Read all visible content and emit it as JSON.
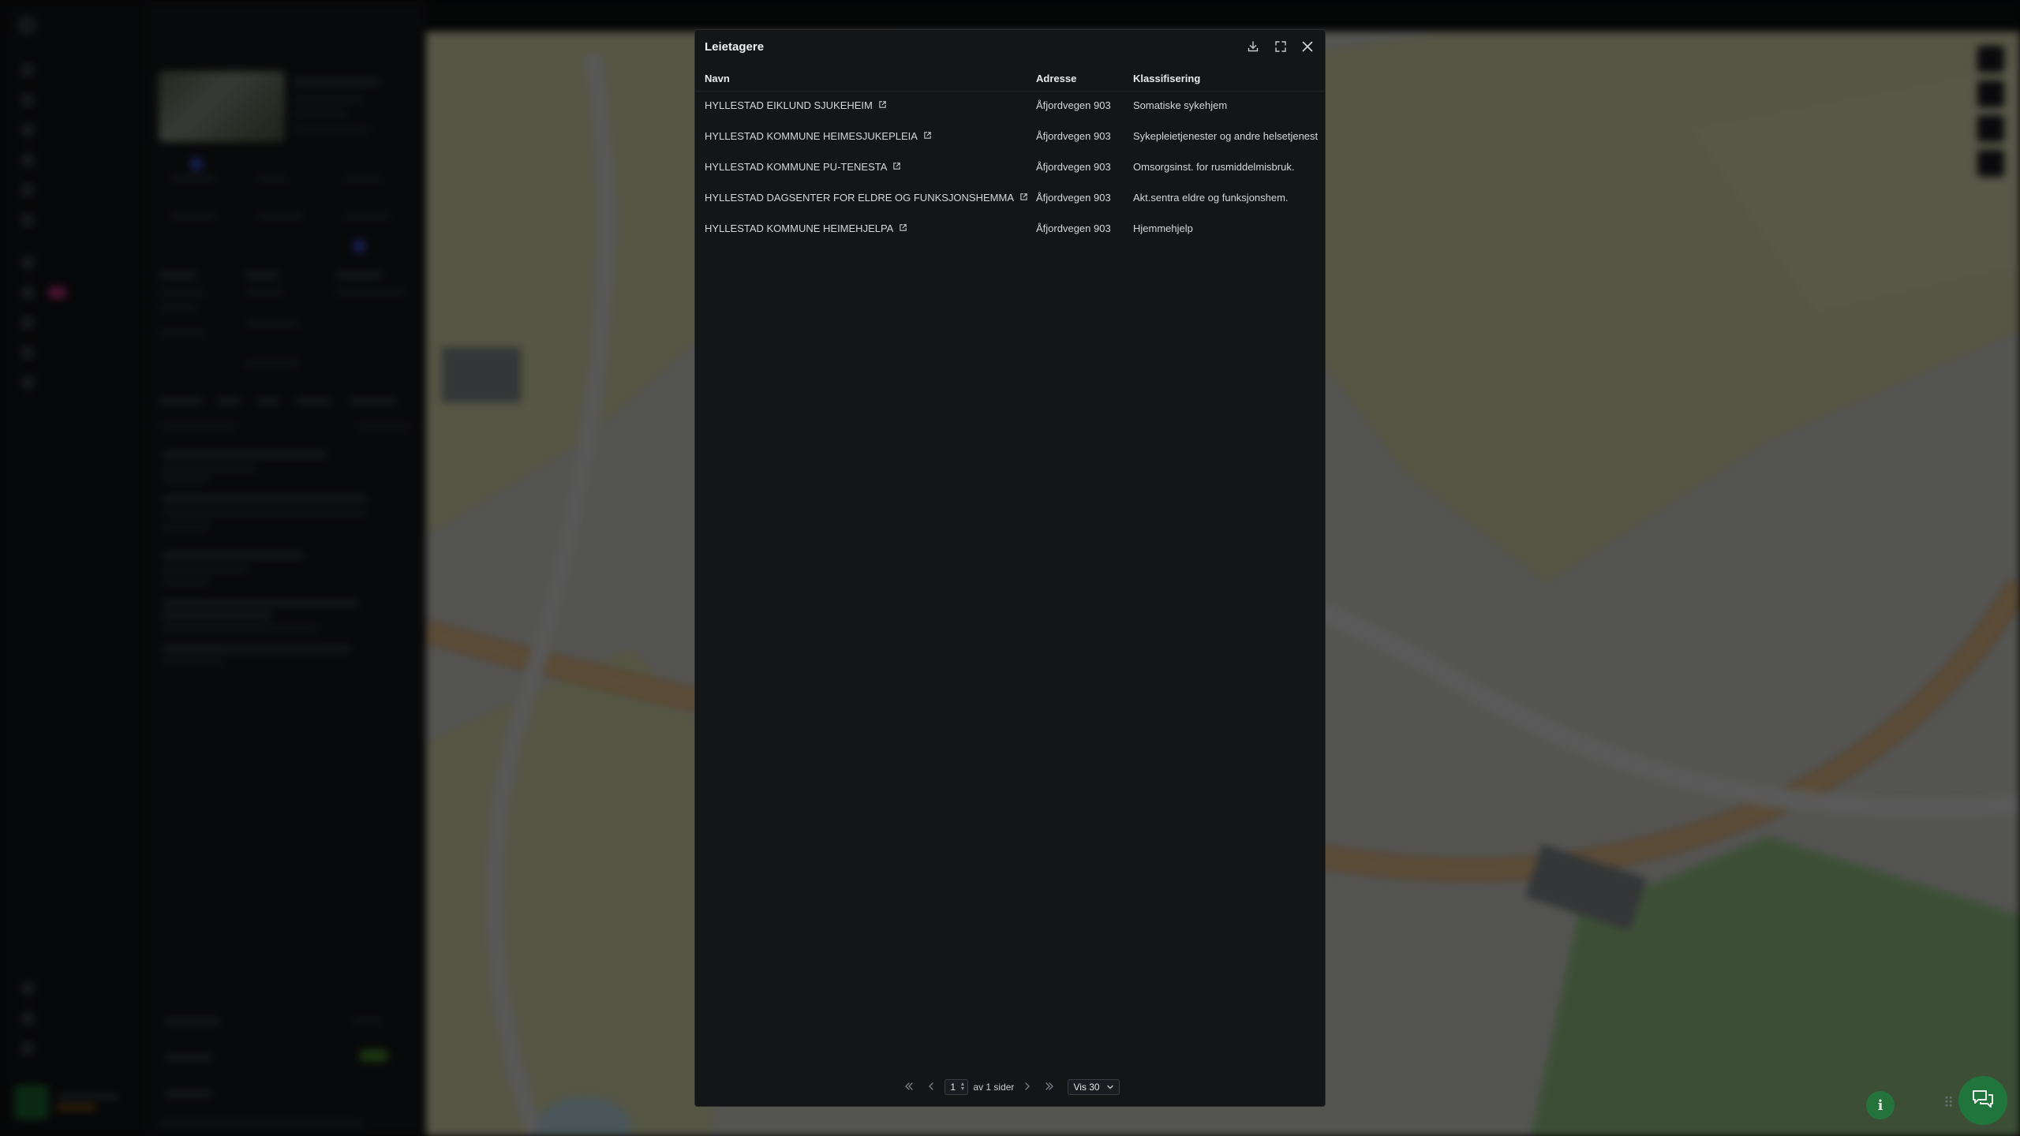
{
  "modal": {
    "title": "Leietagere",
    "columns": {
      "name": "Navn",
      "address": "Adresse",
      "classification": "Klassifisering"
    },
    "rows": [
      {
        "name": "HYLLESTAD EIKLUND SJUKEHEIM",
        "address": "Åfjordvegen 903",
        "classification": "Somatiske sykehjem"
      },
      {
        "name": "HYLLESTAD KOMMUNE HEIMESJUKEPLEIA",
        "address": "Åfjordvegen 903",
        "classification": "Sykepleietjenester og andre helsetjenest"
      },
      {
        "name": "HYLLESTAD KOMMUNE PU-TENESTA",
        "address": "Åfjordvegen 903",
        "classification": "Omsorgsinst. for rusmiddelmisbruk."
      },
      {
        "name": "HYLLESTAD DAGSENTER FOR ELDRE OG FUNKSJONSHEMMA",
        "address": "Åfjordvegen 903",
        "classification": "Akt.sentra eldre og funksjonshem."
      },
      {
        "name": "HYLLESTAD KOMMUNE HEIMEHJELPA",
        "address": "Åfjordvegen 903",
        "classification": "Hjemmehjelp"
      }
    ],
    "pagination": {
      "current_page": "1",
      "of_pages_label": "av 1 sider",
      "page_size_label": "Vis 30"
    },
    "icons": {
      "download": "download-icon",
      "expand": "expand-icon",
      "close": "close-icon",
      "external_link": "external-link-icon"
    }
  },
  "colors": {
    "modal_bg": "#141517",
    "accent_green": "#1e7a3e",
    "map_bg": "#dcdcd6"
  }
}
